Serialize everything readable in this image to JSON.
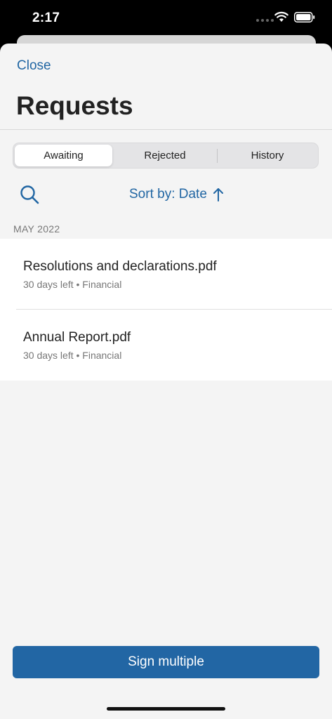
{
  "status_bar": {
    "time": "2:17"
  },
  "header": {
    "close_label": "Close",
    "title": "Requests"
  },
  "tabs": [
    {
      "label": "Awaiting",
      "selected": true
    },
    {
      "label": "Rejected",
      "selected": false
    },
    {
      "label": "History",
      "selected": false
    }
  ],
  "toolbar": {
    "search_icon": "search-icon",
    "sort_label": "Sort by: Date",
    "sort_icon": "arrow-up-icon"
  },
  "section": {
    "title": "MAY 2022"
  },
  "items": [
    {
      "title": "Resolutions and declarations.pdf",
      "meta": "30 days left • Financial"
    },
    {
      "title": "Annual Report.pdf",
      "meta": "30 days left • Financial"
    }
  ],
  "footer": {
    "sign_label": "Sign multiple"
  },
  "colors": {
    "accent": "#2166a3",
    "button": "#2266a4"
  }
}
